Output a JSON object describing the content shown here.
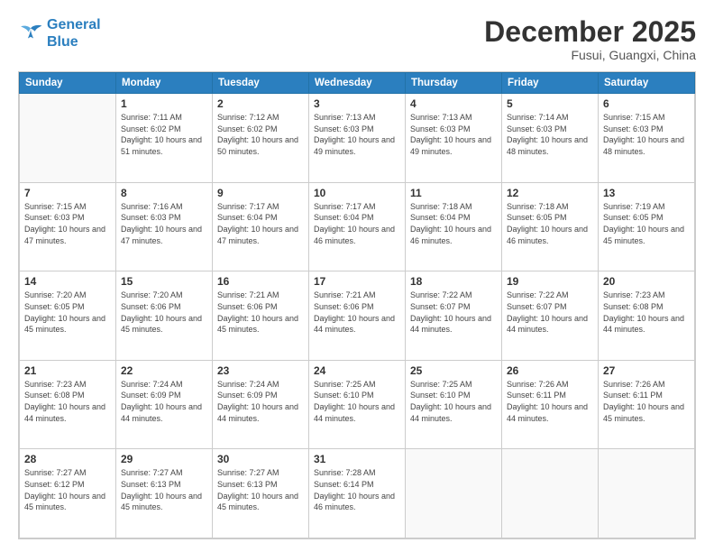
{
  "logo": {
    "line1": "General",
    "line2": "Blue"
  },
  "header": {
    "month": "December 2025",
    "location": "Fusui, Guangxi, China"
  },
  "weekdays": [
    "Sunday",
    "Monday",
    "Tuesday",
    "Wednesday",
    "Thursday",
    "Friday",
    "Saturday"
  ],
  "weeks": [
    [
      {
        "day": "",
        "sunrise": "",
        "sunset": "",
        "daylight": ""
      },
      {
        "day": "1",
        "sunrise": "Sunrise: 7:11 AM",
        "sunset": "Sunset: 6:02 PM",
        "daylight": "Daylight: 10 hours and 51 minutes."
      },
      {
        "day": "2",
        "sunrise": "Sunrise: 7:12 AM",
        "sunset": "Sunset: 6:02 PM",
        "daylight": "Daylight: 10 hours and 50 minutes."
      },
      {
        "day": "3",
        "sunrise": "Sunrise: 7:13 AM",
        "sunset": "Sunset: 6:03 PM",
        "daylight": "Daylight: 10 hours and 49 minutes."
      },
      {
        "day": "4",
        "sunrise": "Sunrise: 7:13 AM",
        "sunset": "Sunset: 6:03 PM",
        "daylight": "Daylight: 10 hours and 49 minutes."
      },
      {
        "day": "5",
        "sunrise": "Sunrise: 7:14 AM",
        "sunset": "Sunset: 6:03 PM",
        "daylight": "Daylight: 10 hours and 48 minutes."
      },
      {
        "day": "6",
        "sunrise": "Sunrise: 7:15 AM",
        "sunset": "Sunset: 6:03 PM",
        "daylight": "Daylight: 10 hours and 48 minutes."
      }
    ],
    [
      {
        "day": "7",
        "sunrise": "Sunrise: 7:15 AM",
        "sunset": "Sunset: 6:03 PM",
        "daylight": "Daylight: 10 hours and 47 minutes."
      },
      {
        "day": "8",
        "sunrise": "Sunrise: 7:16 AM",
        "sunset": "Sunset: 6:03 PM",
        "daylight": "Daylight: 10 hours and 47 minutes."
      },
      {
        "day": "9",
        "sunrise": "Sunrise: 7:17 AM",
        "sunset": "Sunset: 6:04 PM",
        "daylight": "Daylight: 10 hours and 47 minutes."
      },
      {
        "day": "10",
        "sunrise": "Sunrise: 7:17 AM",
        "sunset": "Sunset: 6:04 PM",
        "daylight": "Daylight: 10 hours and 46 minutes."
      },
      {
        "day": "11",
        "sunrise": "Sunrise: 7:18 AM",
        "sunset": "Sunset: 6:04 PM",
        "daylight": "Daylight: 10 hours and 46 minutes."
      },
      {
        "day": "12",
        "sunrise": "Sunrise: 7:18 AM",
        "sunset": "Sunset: 6:05 PM",
        "daylight": "Daylight: 10 hours and 46 minutes."
      },
      {
        "day": "13",
        "sunrise": "Sunrise: 7:19 AM",
        "sunset": "Sunset: 6:05 PM",
        "daylight": "Daylight: 10 hours and 45 minutes."
      }
    ],
    [
      {
        "day": "14",
        "sunrise": "Sunrise: 7:20 AM",
        "sunset": "Sunset: 6:05 PM",
        "daylight": "Daylight: 10 hours and 45 minutes."
      },
      {
        "day": "15",
        "sunrise": "Sunrise: 7:20 AM",
        "sunset": "Sunset: 6:06 PM",
        "daylight": "Daylight: 10 hours and 45 minutes."
      },
      {
        "day": "16",
        "sunrise": "Sunrise: 7:21 AM",
        "sunset": "Sunset: 6:06 PM",
        "daylight": "Daylight: 10 hours and 45 minutes."
      },
      {
        "day": "17",
        "sunrise": "Sunrise: 7:21 AM",
        "sunset": "Sunset: 6:06 PM",
        "daylight": "Daylight: 10 hours and 44 minutes."
      },
      {
        "day": "18",
        "sunrise": "Sunrise: 7:22 AM",
        "sunset": "Sunset: 6:07 PM",
        "daylight": "Daylight: 10 hours and 44 minutes."
      },
      {
        "day": "19",
        "sunrise": "Sunrise: 7:22 AM",
        "sunset": "Sunset: 6:07 PM",
        "daylight": "Daylight: 10 hours and 44 minutes."
      },
      {
        "day": "20",
        "sunrise": "Sunrise: 7:23 AM",
        "sunset": "Sunset: 6:08 PM",
        "daylight": "Daylight: 10 hours and 44 minutes."
      }
    ],
    [
      {
        "day": "21",
        "sunrise": "Sunrise: 7:23 AM",
        "sunset": "Sunset: 6:08 PM",
        "daylight": "Daylight: 10 hours and 44 minutes."
      },
      {
        "day": "22",
        "sunrise": "Sunrise: 7:24 AM",
        "sunset": "Sunset: 6:09 PM",
        "daylight": "Daylight: 10 hours and 44 minutes."
      },
      {
        "day": "23",
        "sunrise": "Sunrise: 7:24 AM",
        "sunset": "Sunset: 6:09 PM",
        "daylight": "Daylight: 10 hours and 44 minutes."
      },
      {
        "day": "24",
        "sunrise": "Sunrise: 7:25 AM",
        "sunset": "Sunset: 6:10 PM",
        "daylight": "Daylight: 10 hours and 44 minutes."
      },
      {
        "day": "25",
        "sunrise": "Sunrise: 7:25 AM",
        "sunset": "Sunset: 6:10 PM",
        "daylight": "Daylight: 10 hours and 44 minutes."
      },
      {
        "day": "26",
        "sunrise": "Sunrise: 7:26 AM",
        "sunset": "Sunset: 6:11 PM",
        "daylight": "Daylight: 10 hours and 44 minutes."
      },
      {
        "day": "27",
        "sunrise": "Sunrise: 7:26 AM",
        "sunset": "Sunset: 6:11 PM",
        "daylight": "Daylight: 10 hours and 45 minutes."
      }
    ],
    [
      {
        "day": "28",
        "sunrise": "Sunrise: 7:27 AM",
        "sunset": "Sunset: 6:12 PM",
        "daylight": "Daylight: 10 hours and 45 minutes."
      },
      {
        "day": "29",
        "sunrise": "Sunrise: 7:27 AM",
        "sunset": "Sunset: 6:13 PM",
        "daylight": "Daylight: 10 hours and 45 minutes."
      },
      {
        "day": "30",
        "sunrise": "Sunrise: 7:27 AM",
        "sunset": "Sunset: 6:13 PM",
        "daylight": "Daylight: 10 hours and 45 minutes."
      },
      {
        "day": "31",
        "sunrise": "Sunrise: 7:28 AM",
        "sunset": "Sunset: 6:14 PM",
        "daylight": "Daylight: 10 hours and 46 minutes."
      },
      {
        "day": "",
        "sunrise": "",
        "sunset": "",
        "daylight": ""
      },
      {
        "day": "",
        "sunrise": "",
        "sunset": "",
        "daylight": ""
      },
      {
        "day": "",
        "sunrise": "",
        "sunset": "",
        "daylight": ""
      }
    ]
  ]
}
